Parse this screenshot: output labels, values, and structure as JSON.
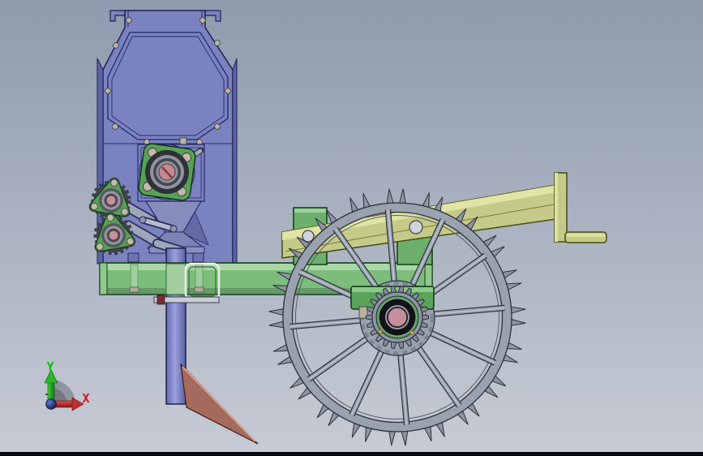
{
  "viewport": {
    "axis_triad": {
      "y_label": "Y",
      "x_label": "X",
      "y_color": "#00c400",
      "x_color": "#d01818"
    },
    "background": {
      "top": "#8d9bad",
      "bottom": "#c7cbd5",
      "bottom_bar": "#06080c"
    },
    "model": {
      "part_colors": {
        "seed_hopper": "#7b82c0",
        "frame_beam": "#7cbd7c",
        "tongue_beam": "#c6ca89",
        "ground_wheel": "#9aa1af",
        "bearing_flange": "#57a257",
        "shaft_center": "#c18b92",
        "furrow_opener": "#a56a5e"
      },
      "wheel": {
        "spike_count": 40,
        "spoke_count": 12,
        "hub_sprocket_tooth_count": 22
      }
    }
  }
}
